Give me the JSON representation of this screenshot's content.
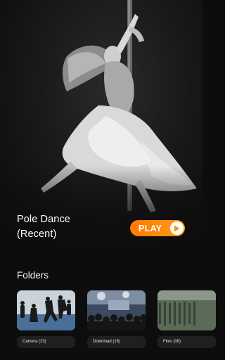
{
  "hero": {
    "title_line1": "Pole Dance",
    "title_line2": "(Recent)",
    "play_label": "PLAY",
    "play_icon": "play-triangle-icon",
    "accent_color": "#ff8a00"
  },
  "folders": {
    "heading": "Folders",
    "items": [
      {
        "label": "Camera (23)",
        "thumb_icon": "dancers-photo"
      },
      {
        "label": "Download (16)",
        "thumb_icon": "crowd-photo"
      },
      {
        "label": "Files (08)",
        "thumb_icon": "stadium-photo"
      }
    ]
  }
}
